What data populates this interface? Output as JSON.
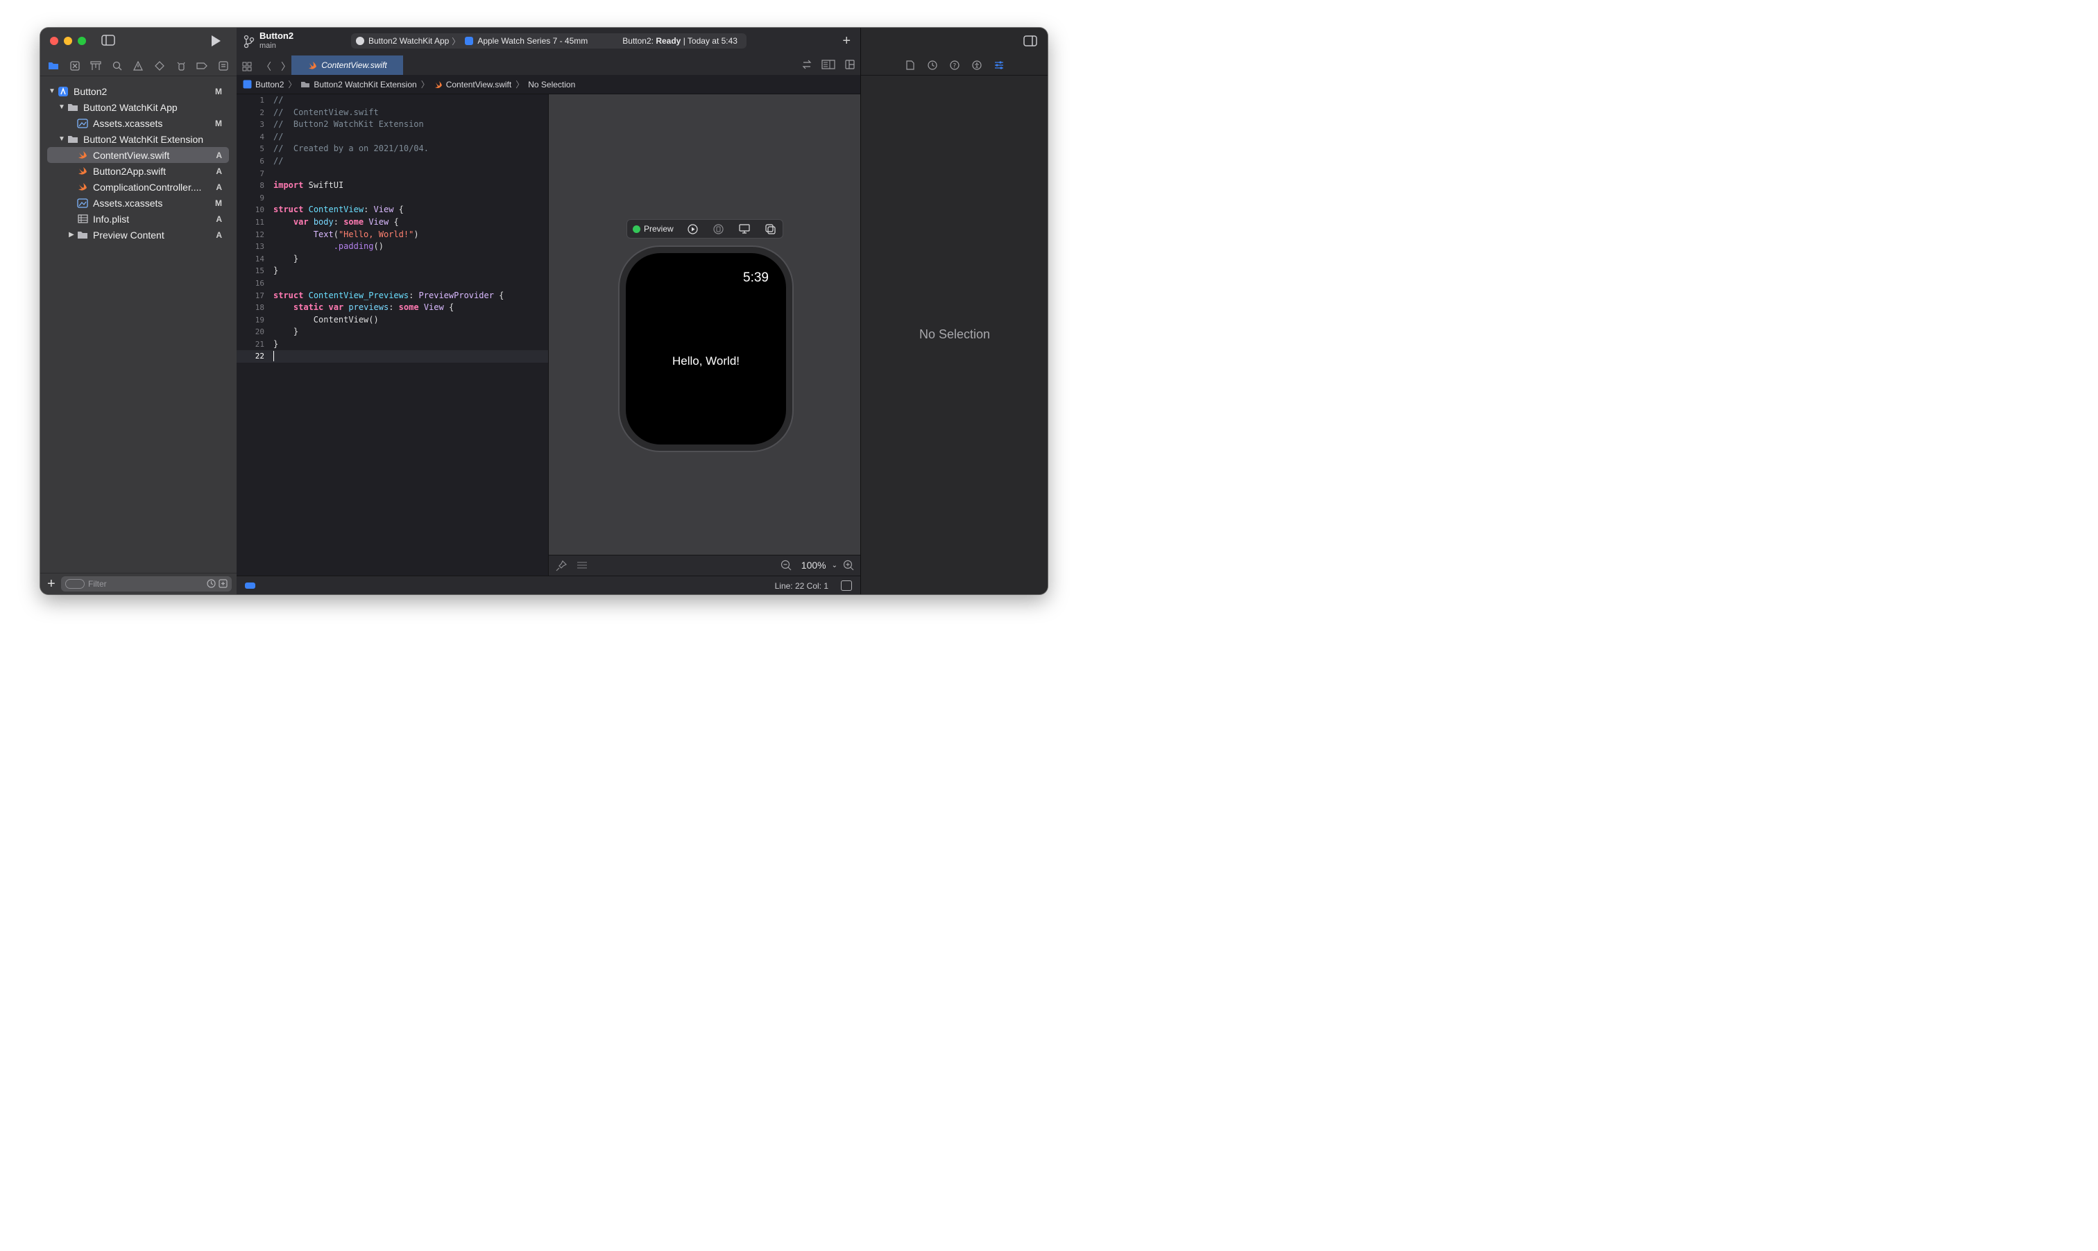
{
  "navigator": {
    "items": [
      {
        "label": "Button2",
        "badge": "M"
      },
      {
        "label": "Button2 WatchKit App",
        "badge": ""
      },
      {
        "label": "Assets.xcassets",
        "badge": "M"
      },
      {
        "label": "Button2 WatchKit Extension",
        "badge": ""
      },
      {
        "label": "ContentView.swift",
        "badge": "A"
      },
      {
        "label": "Button2App.swift",
        "badge": "A"
      },
      {
        "label": "ComplicationController....",
        "badge": "A"
      },
      {
        "label": "Assets.xcassets",
        "badge": "M"
      },
      {
        "label": "Info.plist",
        "badge": "A"
      },
      {
        "label": "Preview Content",
        "badge": "A"
      }
    ],
    "filter_placeholder": "Filter"
  },
  "toolbar": {
    "project_name": "Button2",
    "branch": "main",
    "scheme": "Button2 WatchKit App",
    "device": "Apple Watch Series 7 - 45mm",
    "status_prefix": "Button2:",
    "status_state": "Ready",
    "status_time": "| Today at 5:43"
  },
  "tab": {
    "label": "ContentView.swift"
  },
  "jumpbar": {
    "project": "Button2",
    "group": "Button2 WatchKit Extension",
    "file": "ContentView.swift",
    "selection": "No Selection"
  },
  "code": {
    "line_numbers": [
      "1",
      "2",
      "3",
      "4",
      "5",
      "6",
      "7",
      "8",
      "9",
      "10",
      "11",
      "12",
      "13",
      "14",
      "15",
      "16",
      "17",
      "18",
      "19",
      "20",
      "21",
      "22"
    ],
    "c1": "//",
    "c2": "//  ContentView.swift",
    "c3": "//  Button2 WatchKit Extension",
    "c4": "//",
    "c5": "//  Created by a on 2021/10/04.",
    "c6": "//",
    "import": "import",
    "swiftui": "SwiftUI",
    "struct": "struct",
    "contentview": "ContentView",
    "view": "View",
    "var": "var",
    "body": "body",
    "some": "some",
    "text_fn": "Text",
    "hello_str": "\"Hello, World!\"",
    "padding": ".padding",
    "previews_struct": "ContentView_Previews",
    "preview_provider": "PreviewProvider",
    "static": "static",
    "previews": "previews",
    "contentview_call": "ContentView"
  },
  "canvas": {
    "preview_label": "Preview",
    "watch_time": "5:39",
    "watch_text": "Hello, World!",
    "zoom": "100%"
  },
  "statusbar": {
    "line_col": "Line: 22  Col: 1"
  },
  "inspector": {
    "empty_text": "No Selection"
  },
  "colors": {
    "accent": "#3b82f6",
    "tab_selected": "#3d5a86",
    "keyword": "#ff7ab2",
    "type": "#6bdfff",
    "string": "#ff8170"
  }
}
